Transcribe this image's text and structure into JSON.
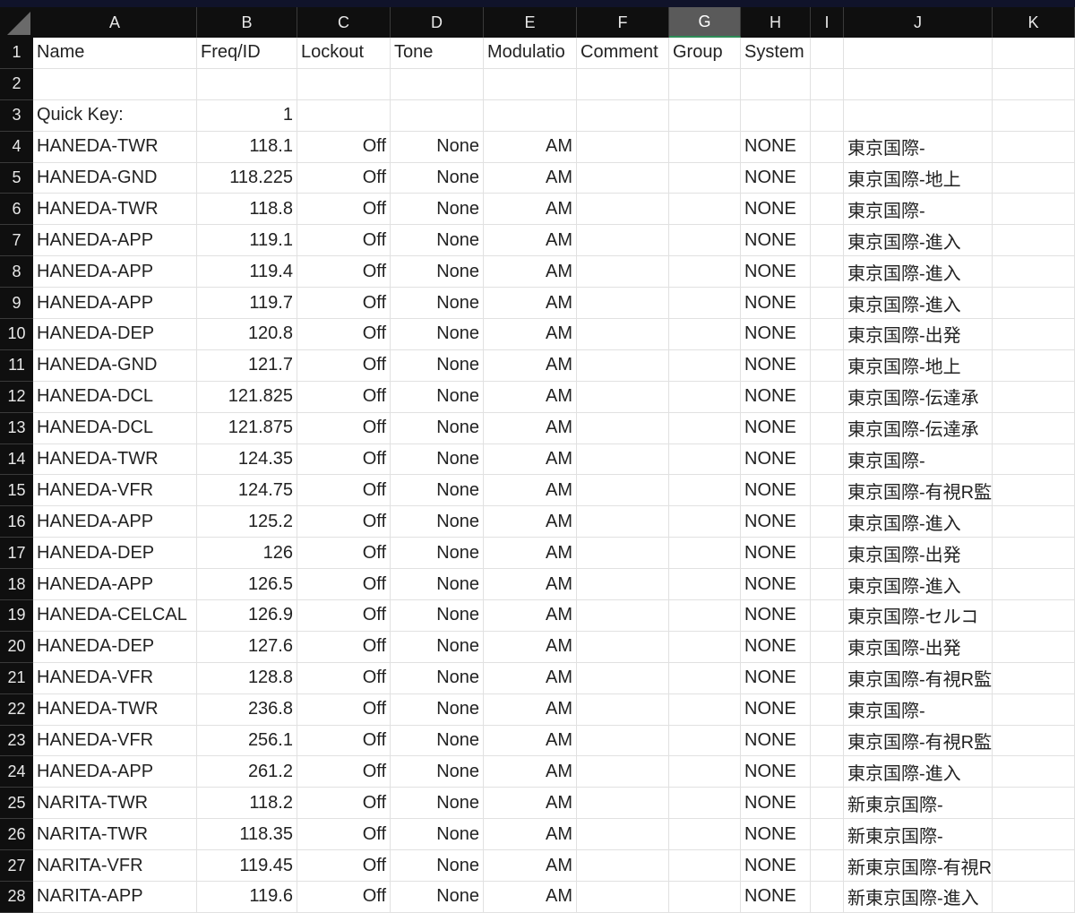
{
  "columns": [
    "A",
    "B",
    "C",
    "D",
    "E",
    "F",
    "G",
    "H",
    "I",
    "J",
    "K"
  ],
  "selected_column": "G",
  "header_row": [
    "Name",
    "Freq/ID",
    "Lockout",
    "Tone",
    "Modulatio",
    "Comment",
    "Group",
    "System",
    "",
    "",
    ""
  ],
  "quick_key": {
    "label": "Quick Key:",
    "value": "1"
  },
  "rows": [
    [
      "HANEDA-TWR",
      "118.1",
      "Off",
      "None",
      "AM",
      "NONE",
      "東京国際-"
    ],
    [
      "HANEDA-GND",
      "118.225",
      "Off",
      "None",
      "AM",
      "NONE",
      "東京国際-地上"
    ],
    [
      "HANEDA-TWR",
      "118.8",
      "Off",
      "None",
      "AM",
      "NONE",
      "東京国際-"
    ],
    [
      "HANEDA-APP",
      "119.1",
      "Off",
      "None",
      "AM",
      "NONE",
      "東京国際-進入"
    ],
    [
      "HANEDA-APP",
      "119.4",
      "Off",
      "None",
      "AM",
      "NONE",
      "東京国際-進入"
    ],
    [
      "HANEDA-APP",
      "119.7",
      "Off",
      "None",
      "AM",
      "NONE",
      "東京国際-進入"
    ],
    [
      "HANEDA-DEP",
      "120.8",
      "Off",
      "None",
      "AM",
      "NONE",
      "東京国際-出発"
    ],
    [
      "HANEDA-GND",
      "121.7",
      "Off",
      "None",
      "AM",
      "NONE",
      "東京国際-地上"
    ],
    [
      "HANEDA-DCL",
      "121.825",
      "Off",
      "None",
      "AM",
      "NONE",
      "東京国際-伝達承"
    ],
    [
      "HANEDA-DCL",
      "121.875",
      "Off",
      "None",
      "AM",
      "NONE",
      "東京国際-伝達承"
    ],
    [
      "HANEDA-TWR",
      "124.35",
      "Off",
      "None",
      "AM",
      "NONE",
      "東京国際-"
    ],
    [
      "HANEDA-VFR",
      "124.75",
      "Off",
      "None",
      "AM",
      "NONE",
      "東京国際-有視R監"
    ],
    [
      "HANEDA-APP",
      "125.2",
      "Off",
      "None",
      "AM",
      "NONE",
      "東京国際-進入"
    ],
    [
      "HANEDA-DEP",
      "126",
      "Off",
      "None",
      "AM",
      "NONE",
      "東京国際-出発"
    ],
    [
      "HANEDA-APP",
      "126.5",
      "Off",
      "None",
      "AM",
      "NONE",
      "東京国際-進入"
    ],
    [
      "HANEDA-CELCAL",
      "126.9",
      "Off",
      "None",
      "AM",
      "NONE",
      "東京国際-セルコ"
    ],
    [
      "HANEDA-DEP",
      "127.6",
      "Off",
      "None",
      "AM",
      "NONE",
      "東京国際-出発"
    ],
    [
      "HANEDA-VFR",
      "128.8",
      "Off",
      "None",
      "AM",
      "NONE",
      "東京国際-有視R監"
    ],
    [
      "HANEDA-TWR",
      "236.8",
      "Off",
      "None",
      "AM",
      "NONE",
      "東京国際-"
    ],
    [
      "HANEDA-VFR",
      "256.1",
      "Off",
      "None",
      "AM",
      "NONE",
      "東京国際-有視R監"
    ],
    [
      "HANEDA-APP",
      "261.2",
      "Off",
      "None",
      "AM",
      "NONE",
      "東京国際-進入"
    ],
    [
      "NARITA-TWR",
      "118.2",
      "Off",
      "None",
      "AM",
      "NONE",
      "新東京国際-"
    ],
    [
      "NARITA-TWR",
      "118.35",
      "Off",
      "None",
      "AM",
      "NONE",
      "新東京国際-"
    ],
    [
      "NARITA-VFR",
      "119.45",
      "Off",
      "None",
      "AM",
      "NONE",
      "新東京国際-有視R"
    ],
    [
      "NARITA-APP",
      "119.6",
      "Off",
      "None",
      "AM",
      "NONE",
      "新東京国際-進入"
    ]
  ]
}
